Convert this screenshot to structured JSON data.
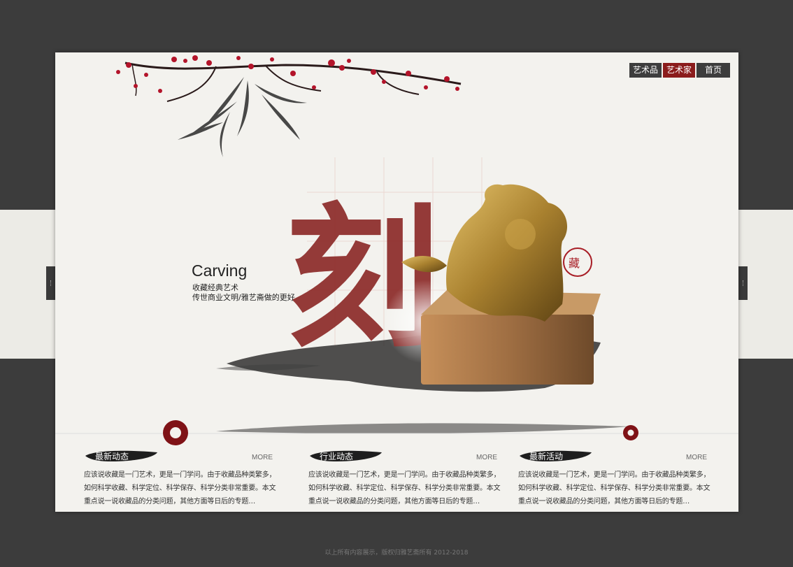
{
  "nav": {
    "items": [
      {
        "label": "艺术品",
        "active": false
      },
      {
        "label": "艺术家",
        "active": true
      },
      {
        "label": "首页",
        "active": false
      }
    ]
  },
  "hero": {
    "title": "Carving",
    "subtitle1": "收藏经典艺术",
    "subtitle2": "传世商业文明/雅艺斋做的更好",
    "calligraphy": "刻"
  },
  "colors": {
    "background": "#3c3c3c",
    "panel": "#f3f2ee",
    "accent": "#8b1c1c",
    "seal_bronze": "#b08a3e"
  },
  "news": [
    {
      "label": "最新动态",
      "more": "MORE",
      "lines": [
        "应该说收藏是一门艺术，更是一门学问。由于收藏品种类繁多，",
        "如何科学收藏、科学定位、科学保存、科学分类非常重要。本文",
        "重点说一说收藏品的分类问题，其他方面等日后的专题…"
      ]
    },
    {
      "label": "行业动态",
      "more": "MORE",
      "lines": [
        "应该说收藏是一门艺术，更是一门学问。由于收藏品种类繁多，",
        "如何科学收藏、科学定位、科学保存、科学分类非常重要。本文",
        "重点说一说收藏品的分类问题，其他方面等日后的专题…"
      ]
    },
    {
      "label": "最新活动",
      "more": "MORE",
      "lines": [
        "应该说收藏是一门艺术，更是一门学问。由于收藏品种类繁多，",
        "如何科学收藏、科学定位、科学保存、科学分类非常重要。本文",
        "重点说一说收藏品的分类问题，其他方面等日后的专题…"
      ]
    }
  ],
  "footer": {
    "text": "以上所有内容展示，版权归雅艺斋所有    2012-2018"
  }
}
